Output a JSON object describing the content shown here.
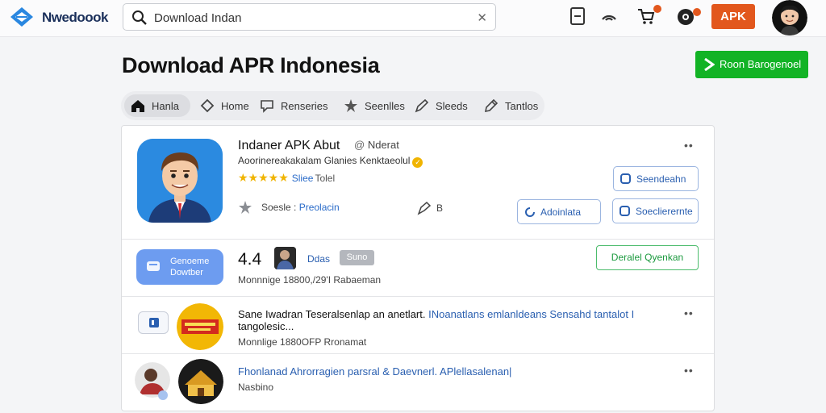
{
  "topbar": {
    "logo_text": "Nwedoook",
    "search": {
      "value": "Download Indan",
      "placeholder": ""
    },
    "clear_symbol": "✕",
    "apk_label": "APK"
  },
  "page": {
    "title": "Download APR Indonesia",
    "green_button_label": "Roon Barogenoel"
  },
  "tabs": [
    {
      "label": "Hanla",
      "icon": "home-icon"
    },
    {
      "label": "Home",
      "icon": "diamond-icon"
    },
    {
      "label": "Renseries",
      "icon": "chat-icon"
    },
    {
      "label": "Seenlles",
      "icon": "star-icon"
    },
    {
      "label": "Sleeds",
      "icon": "pen-icon"
    },
    {
      "label": "Tantlos",
      "icon": "pencil-icon"
    }
  ],
  "app": {
    "title": "Indaner APK Abut",
    "developer": "Nderat",
    "subtitle": "Aoorinereakakalam Glanies Kenktaeolul",
    "stars": "★★★★★",
    "rating_label": "Sliee",
    "rating_label2": "Tolel",
    "meta_prefix": "Soesle :",
    "meta_link": "Preolacin",
    "share_count": "B",
    "buttons": {
      "top_right": "Seendeahn",
      "mid_left": "Adoinlata",
      "mid_right": "Soeclierernte"
    }
  },
  "download_row": {
    "pill_line1": "Genoeme",
    "pill_line2": "Dowtber",
    "rating": "4.4",
    "rating_label": "Ddas",
    "tag": "Suno",
    "meta": "Monnnige 18800,/29'I Rabaeman",
    "green_button": "Deralel Qyenkan"
  },
  "list": [
    {
      "headline_prefix": "Sane Iwadran Teseralsenlap an anetlart.",
      "headline_link": "INoanatlans emlanldeans Sensahd tantalot I",
      "headline_cont": "tangolesic...",
      "sub": "Monnlige 1880OFP Rronamat"
    },
    {
      "headline_prefix": "",
      "headline_link": "Fhonlanad Ahrorragien parsral & Daevnerl.",
      "headline_link2": "APlellasalenan|",
      "sub": "Nasbino"
    }
  ],
  "more_symbol": "••",
  "colors": {
    "accent": "#e2571d",
    "primary_green": "#12b325",
    "link_blue": "#2a5fb0",
    "star_gold": "#f0b400"
  }
}
